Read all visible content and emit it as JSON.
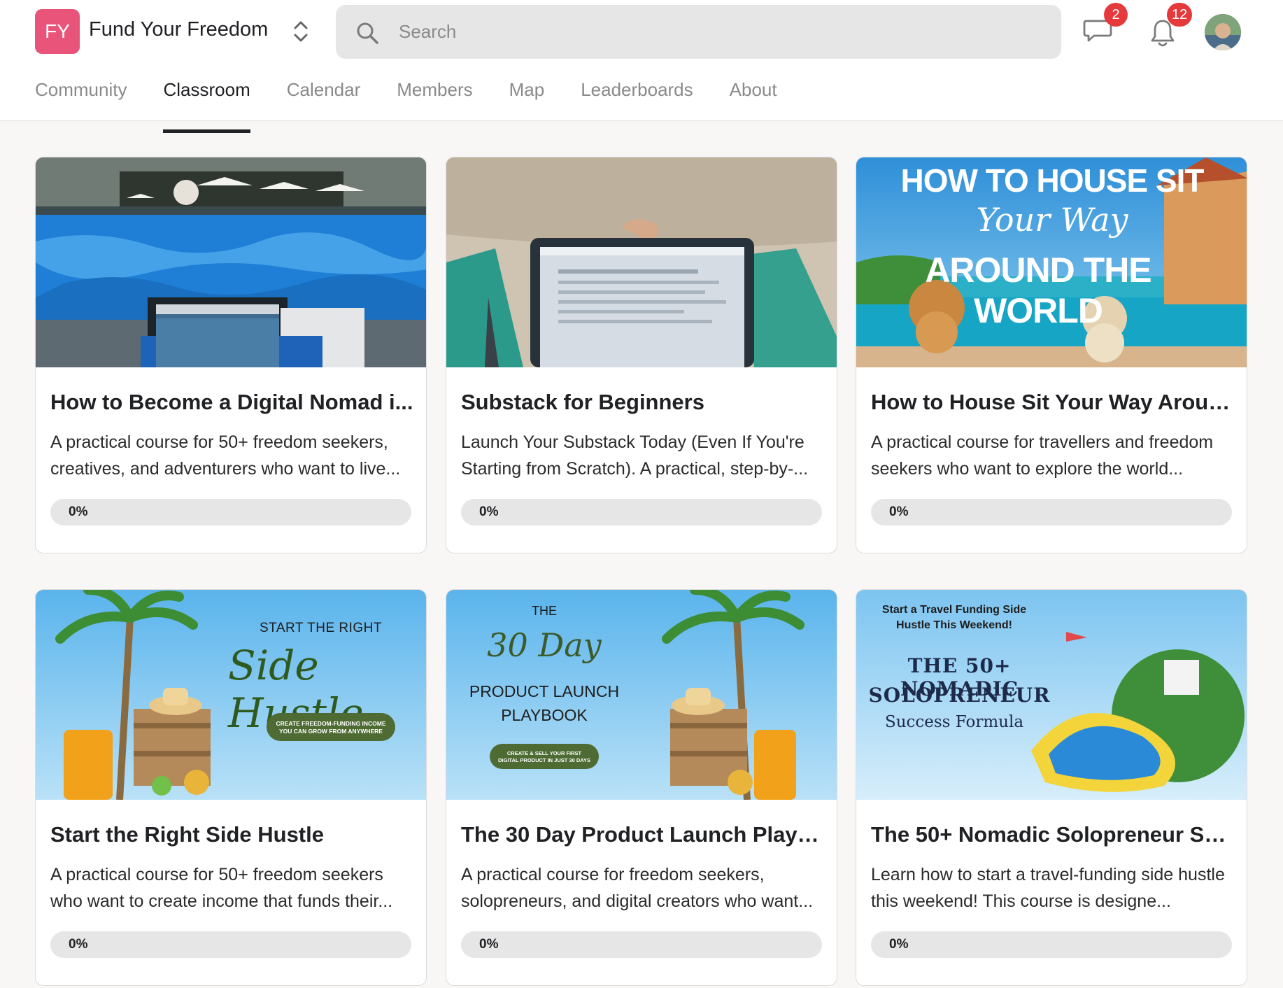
{
  "header": {
    "logo_initials": "FY",
    "logo_color": "#e8547a",
    "group_name": "Fund Your Freedom",
    "search_placeholder": "Search",
    "chat_badge": "2",
    "notifications_badge": "12",
    "badge_color": "#e5393b"
  },
  "tabs": [
    {
      "label": "Community",
      "active": false
    },
    {
      "label": "Classroom",
      "active": true
    },
    {
      "label": "Calendar",
      "active": false
    },
    {
      "label": "Members",
      "active": false
    },
    {
      "label": "Map",
      "active": false
    },
    {
      "label": "Leaderboards",
      "active": false
    },
    {
      "label": "About",
      "active": false
    }
  ],
  "courses": [
    {
      "title": "How to Become a Digital Nomad i...",
      "description": "A practical course for 50+ freedom seekers, creatives, and adventurers who want to live...",
      "progress_label": "0%",
      "progress": 0,
      "thumb_text": {}
    },
    {
      "title": "Substack for Beginners",
      "description": "Launch Your Substack Today (Even If You're Starting from Scratch). A practical, step-by-...",
      "progress_label": "0%",
      "progress": 0,
      "thumb_text": {}
    },
    {
      "title": "How to House Sit Your Way Aroun...",
      "description": "A practical course for travellers and freedom seekers who want to explore the world...",
      "progress_label": "0%",
      "progress": 0,
      "thumb_text": {
        "line1": "HOW TO HOUSE SIT",
        "line2": "Your Way",
        "line3": "AROUND THE WORLD"
      }
    },
    {
      "title": "Start the Right Side Hustle",
      "description": "A practical course for 50+ freedom seekers who want to create income that funds their...",
      "progress_label": "0%",
      "progress": 0,
      "thumb_text": {
        "line1": "START THE RIGHT",
        "line2": "Side Hustle",
        "pill_line1": "CREATE FREEDOM-FUNDING INCOME",
        "pill_line2": "YOU CAN GROW FROM ANYWHERE"
      }
    },
    {
      "title": "The 30 Day Product Launch Playb...",
      "description": "A practical course for freedom seekers, solopreneurs, and digital creators who want...",
      "progress_label": "0%",
      "progress": 0,
      "thumb_text": {
        "line1": "THE",
        "line2": "30 Day",
        "line3": "PRODUCT LAUNCH",
        "line4": "PLAYBOOK",
        "pill_line1": "CREATE & SELL YOUR FIRST",
        "pill_line2": "DIGITAL PRODUCT IN JUST 30 DAYS"
      }
    },
    {
      "title": "The 50+ Nomadic Solopreneur Su...",
      "description": "Learn how to start a travel-funding side hustle this weekend! This course is designe...",
      "progress_label": "0%",
      "progress": 0,
      "thumb_text": {
        "line1": "Start a Travel Funding Side",
        "line2": "Hustle This Weekend!",
        "line3": "THE 50+ NOMADIC",
        "line4": "SOLOPRENEUR",
        "line5": "Success Formula"
      }
    }
  ]
}
